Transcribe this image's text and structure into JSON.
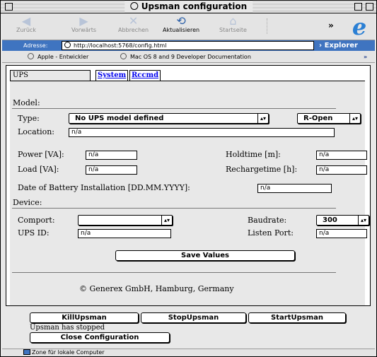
{
  "window": {
    "title": "Upsman configuration"
  },
  "toolbar": {
    "back": "Zurück",
    "forward": "Vorwärts",
    "stop": "Abbrechen",
    "refresh": "Aktualisieren",
    "home": "Startseite",
    "overflow": "»"
  },
  "address": {
    "label": "Adresse:",
    "url": "http://localhost:5768/config.html",
    "go_label": "› Explorer"
  },
  "favorites": {
    "items": [
      "Apple - Entwickler",
      "Mac OS 8 and 9 Developer Documentation"
    ],
    "overflow": "»"
  },
  "tabs": {
    "ups": "UPS",
    "system": "System",
    "rccmd": "Rccmd"
  },
  "model": {
    "heading": "Model:",
    "type_label": "Type:",
    "type_value": "No UPS model defined",
    "open_value": "R-Open",
    "location_label": "Location:",
    "location_value": "n/a"
  },
  "power": {
    "power_label": "Power [VA]:",
    "power_value": "n/a",
    "load_label": "Load [VA]:",
    "load_value": "n/a",
    "holdtime_label": "Holdtime [m]:",
    "holdtime_value": "n/a",
    "recharge_label": "Rechargetime [h]:",
    "recharge_value": "n/a",
    "battery_label": "Date of Battery Installation [DD.MM.YYYY]:",
    "battery_value": "n/a"
  },
  "device": {
    "heading": "Device:",
    "comport_label": "Comport:",
    "comport_value": "",
    "baud_label": "Baudrate:",
    "baud_value": "300",
    "upsid_label": "UPS ID:",
    "upsid_value": "n/a",
    "listen_label": "Listen Port:",
    "listen_value": "n/a"
  },
  "save_label": "Save Values",
  "copyright": "© Generex GmbH, Hamburg, Germany",
  "controls": {
    "kill": "KillUpsman",
    "stop": "StopUpsman",
    "start": "StartUpsman",
    "status": "Upsman has stopped",
    "close": "Close Configuration"
  },
  "statusbar": {
    "zone": "Zone für lokale Computer"
  }
}
